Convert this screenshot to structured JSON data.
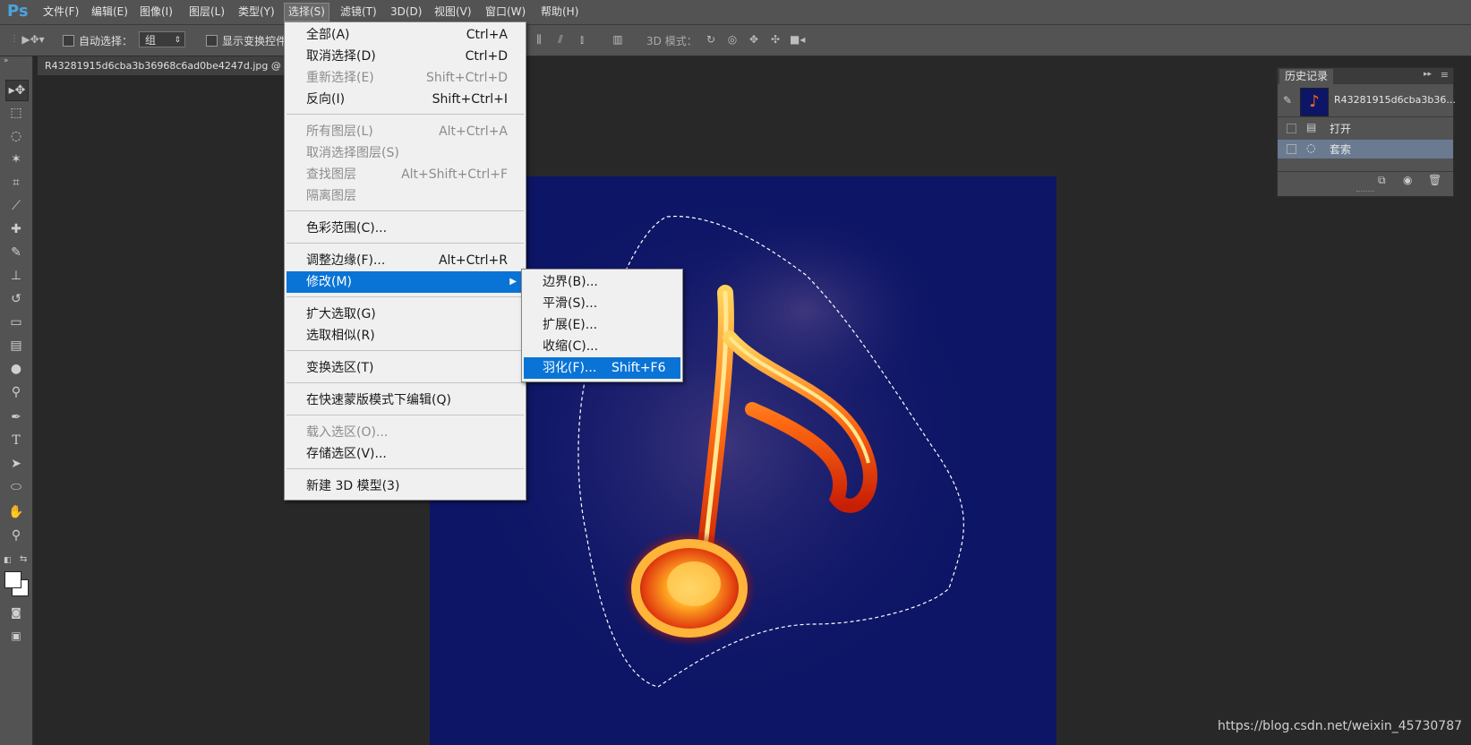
{
  "app": {
    "logo": "Ps"
  },
  "menubar": {
    "items": [
      "文件(F)",
      "编辑(E)",
      "图像(I)",
      "图层(L)",
      "类型(Y)",
      "选择(S)",
      "滤镜(T)",
      "3D(D)",
      "视图(V)",
      "窗口(W)",
      "帮助(H)"
    ],
    "active": "选择(S)"
  },
  "options": {
    "auto_select_label": "自动选择：",
    "auto_select_value": "组",
    "show_transform_label": "显示变换控件",
    "mode_3d_label": "3D 模式："
  },
  "document": {
    "tab_title": "R43281915d6cba3b36968c6ad0be4247d.jpg @"
  },
  "select_menu": {
    "items": [
      {
        "label": "全部(A)",
        "shortcut": "Ctrl+A",
        "disabled": false
      },
      {
        "label": "取消选择(D)",
        "shortcut": "Ctrl+D",
        "disabled": false
      },
      {
        "label": "重新选择(E)",
        "shortcut": "Shift+Ctrl+D",
        "disabled": true
      },
      {
        "label": "反向(I)",
        "shortcut": "Shift+Ctrl+I",
        "disabled": false
      },
      {
        "label": "所有图层(L)",
        "shortcut": "Alt+Ctrl+A",
        "disabled": true
      },
      {
        "label": "取消选择图层(S)",
        "shortcut": "",
        "disabled": true
      },
      {
        "label": "查找图层",
        "shortcut": "Alt+Shift+Ctrl+F",
        "disabled": true
      },
      {
        "label": "隔离图层",
        "shortcut": "",
        "disabled": true
      },
      {
        "label": "色彩范围(C)...",
        "shortcut": "",
        "disabled": false
      },
      {
        "label": "调整边缘(F)...",
        "shortcut": "Alt+Ctrl+R",
        "disabled": false
      },
      {
        "label": "修改(M)",
        "shortcut": "",
        "disabled": false
      },
      {
        "label": "扩大选取(G)",
        "shortcut": "",
        "disabled": false
      },
      {
        "label": "选取相似(R)",
        "shortcut": "",
        "disabled": false
      },
      {
        "label": "变换选区(T)",
        "shortcut": "",
        "disabled": false
      },
      {
        "label": "在快速蒙版模式下编辑(Q)",
        "shortcut": "",
        "disabled": false
      },
      {
        "label": "载入选区(O)...",
        "shortcut": "",
        "disabled": true
      },
      {
        "label": "存储选区(V)...",
        "shortcut": "",
        "disabled": false
      },
      {
        "label": "新建 3D 模型(3)",
        "shortcut": "",
        "disabled": false
      }
    ],
    "highlighted": "修改(M)"
  },
  "modify_submenu": {
    "items": [
      {
        "label": "边界(B)...",
        "shortcut": ""
      },
      {
        "label": "平滑(S)...",
        "shortcut": ""
      },
      {
        "label": "扩展(E)...",
        "shortcut": ""
      },
      {
        "label": "收缩(C)...",
        "shortcut": ""
      },
      {
        "label": "羽化(F)...",
        "shortcut": "Shift+F6"
      }
    ],
    "highlighted": "羽化(F)..."
  },
  "history_panel": {
    "tab": "历史记录",
    "snapshot": "R43281915d6cba3b36...",
    "steps": [
      "打开",
      "套索"
    ],
    "selected_step": "套索"
  },
  "watermark": "https://blog.csdn.net/weixin_45730787",
  "colors": {
    "canvas": "#0d1566",
    "highlight": "#0a74d6",
    "panel": "#535353"
  }
}
